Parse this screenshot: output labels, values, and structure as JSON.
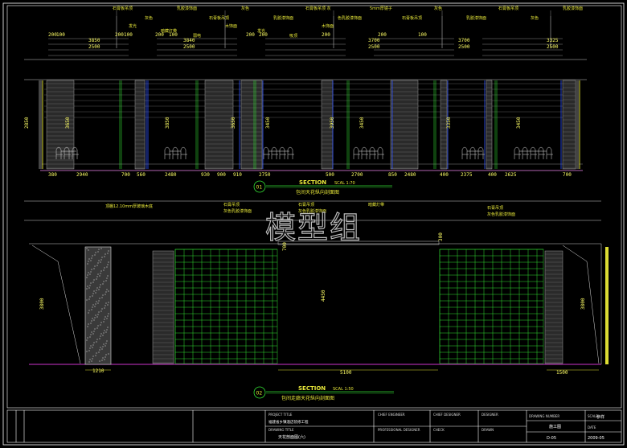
{
  "watermark": "模型组",
  "section1": {
    "number": "01",
    "title": "SECTION",
    "scale": "SCAL 1:70",
    "caption": "包间天花纵向剖面图",
    "bottom_dims": [
      "380",
      "2940",
      "700",
      "560",
      "2480",
      "930",
      "900",
      "910",
      "2750",
      "500",
      "2700",
      "850",
      "2480",
      "400",
      "2375",
      "400",
      "2625",
      "700"
    ],
    "height_dims": [
      "2850",
      "3650",
      "3850",
      "3650",
      "3450",
      "3950",
      "3450",
      "3350",
      "3450"
    ],
    "top_dims": [
      "3850",
      "3840",
      "3700",
      "3700",
      "3325"
    ],
    "top_dims_2": [
      "2500",
      "2500",
      "2500",
      "2500",
      "2500"
    ],
    "small_dims": [
      "200",
      "100",
      "200",
      "100",
      "200",
      "100",
      "200",
      "200",
      "200",
      "200",
      "100"
    ],
    "labels": [
      "石膏板吊顶",
      "灰色",
      "乳胶漆饰面",
      "石膏板吊顶",
      "灰色",
      "乳胶漆饰面",
      "石膏板吊顶 灰",
      "色乳胶漆饰面",
      "5mm厚镜子",
      "石膏板吊顶",
      "灰色",
      "乳胶漆饰面",
      "石膏板吊顶",
      "灰色",
      "乳胶漆饰面",
      "发光",
      "暗藏灯带",
      "弱电",
      "木饰面",
      "发光",
      "吸顶",
      "木饰面"
    ]
  },
  "section2": {
    "number": "02",
    "title": "SECTION",
    "scale": "SCAL 1:50",
    "caption": "包间走廊天花纵向剖面图",
    "dims": [
      "1210",
      "5100",
      "1500",
      "3800",
      "4450",
      "3800",
      "700",
      "300"
    ],
    "labels": [
      "顶棚12.10mm厚玻璃木底",
      "石膏吊顶",
      "灰色乳胶漆饰面",
      "石膏吊顶",
      "灰色乳胶漆饰面",
      "暗藏灯带",
      "石膏吊顶",
      "灰色乳胶漆饰面"
    ]
  },
  "title_block": {
    "project_title_label": "PROJECT TITLE",
    "project_title": "福建省乡镇酒店装修工程",
    "drawing_title_label": "DRAWING TITLE",
    "drawing_title": "天花剖面图(六)",
    "chief_engineer": "CHIEF ENGINEER",
    "chief_designer": "CHIEF DESIGNER",
    "professional_designer": "PROFESSIONAL DESIGNER",
    "check": "CHECK",
    "designer": "DESIGNER",
    "drawn": "DRAWN",
    "drawing_number_label": "DRAWING NUMBER",
    "drawing_number": "施工图",
    "phase": "D-05",
    "scale_label": "SCALE",
    "scale": "参样",
    "date_label": "DATE",
    "date": "2009-05"
  }
}
